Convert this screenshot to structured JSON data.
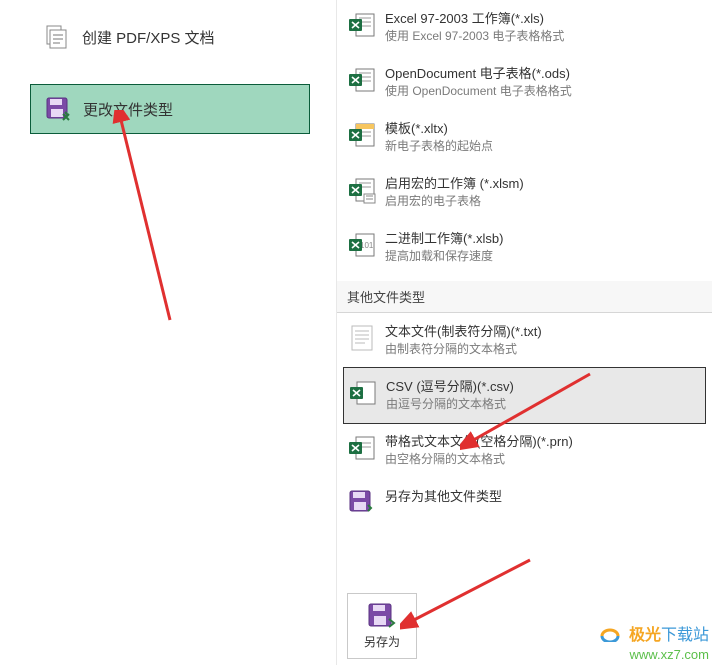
{
  "left": {
    "create_label": "创建 PDF/XPS 文档",
    "change_label": "更改文件类型"
  },
  "right": {
    "workbook_types": [
      {
        "title": "Excel 97-2003 工作簿(*.xls)",
        "desc": "使用 Excel 97-2003 电子表格格式"
      },
      {
        "title": "OpenDocument 电子表格(*.ods)",
        "desc": "使用 OpenDocument 电子表格格式"
      },
      {
        "title": "模板(*.xltx)",
        "desc": "新电子表格的起始点"
      },
      {
        "title": "启用宏的工作簿 (*.xlsm)",
        "desc": "启用宏的电子表格"
      },
      {
        "title": "二进制工作簿(*.xlsb)",
        "desc": "提高加载和保存速度"
      }
    ],
    "other_header": "其他文件类型",
    "other_types": [
      {
        "title": "文本文件(制表符分隔)(*.txt)",
        "desc": "由制表符分隔的文本格式"
      },
      {
        "title": "CSV (逗号分隔)(*.csv)",
        "desc": "由逗号分隔的文本格式"
      },
      {
        "title": "带格式文本文件(空格分隔)(*.prn)",
        "desc": "由空格分隔的文本格式"
      },
      {
        "title": "另存为其他文件类型",
        "desc": ""
      }
    ],
    "saveas_label": "另存为"
  },
  "watermark": {
    "brand_left": "极光",
    "brand_right": "下载站",
    "url": "www.xz7.com"
  }
}
